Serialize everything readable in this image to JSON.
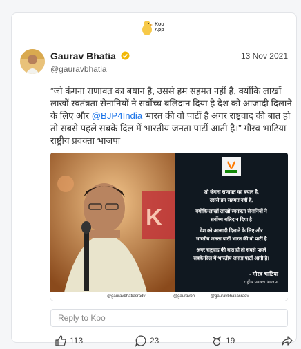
{
  "app": {
    "logo_text_line1": "Koo",
    "logo_text_line2": "App"
  },
  "post": {
    "author_name": "Gaurav Bhatia",
    "handle": "@gauravbhatia",
    "date": "13 Nov 2021",
    "text_part1": "”जो कंगना राणावत का बयान है, उससे हम सहमत नहीं है, क्योंकि लाखों लाखों स्वतंत्रता सेनानियों ने सर्वोच्च बलिदान दिया है देश को आजादी दिलाने के लिए और ",
    "mention": "@BJP4India",
    "text_part2": " भारत की वो पार्टी है अगर राष्ट्रवाद की बात हो तो सबसे पहले सबके दिल में भारतीय जनता पार्टी आती है।” गौरव भाटिया राष्ट्रीय प्रवक्ता भाजपा"
  },
  "image": {
    "quote_lines": [
      "जो कंगना राणावत का बयान है,",
      "उससे हम सहमत नहीं है,",
      "क्योंकि लाखों लाखों स्वतंत्रता सेनानियों ने",
      "सर्वोच्च बलिदान दिया है",
      "देश को आजादी दिलाने के लिए और",
      "भारतीय जनता पार्टी भारत की वो पार्टी है",
      "अगर राष्ट्रवाद की बात हो तो सबसे पहले",
      "सबके दिल में भारतीय जनता पार्टी आती है।"
    ],
    "attribution_name": "- गौरव भाटिया",
    "attribution_role": "राष्ट्रीय प्रवक्ता भाजपा",
    "social_facebook": "@gauravbhatiasradv",
    "social_twitter": "@gauravbh",
    "social_instagram": "@gauravbhatiasradv"
  },
  "reply": {
    "placeholder": "Reply to Koo"
  },
  "actions": {
    "likes": "113",
    "comments": "23",
    "rekoos": "19"
  },
  "colors": {
    "accent": "#1a73e8",
    "verified": "#f2b705",
    "koo_yellow": "#f7c948"
  }
}
